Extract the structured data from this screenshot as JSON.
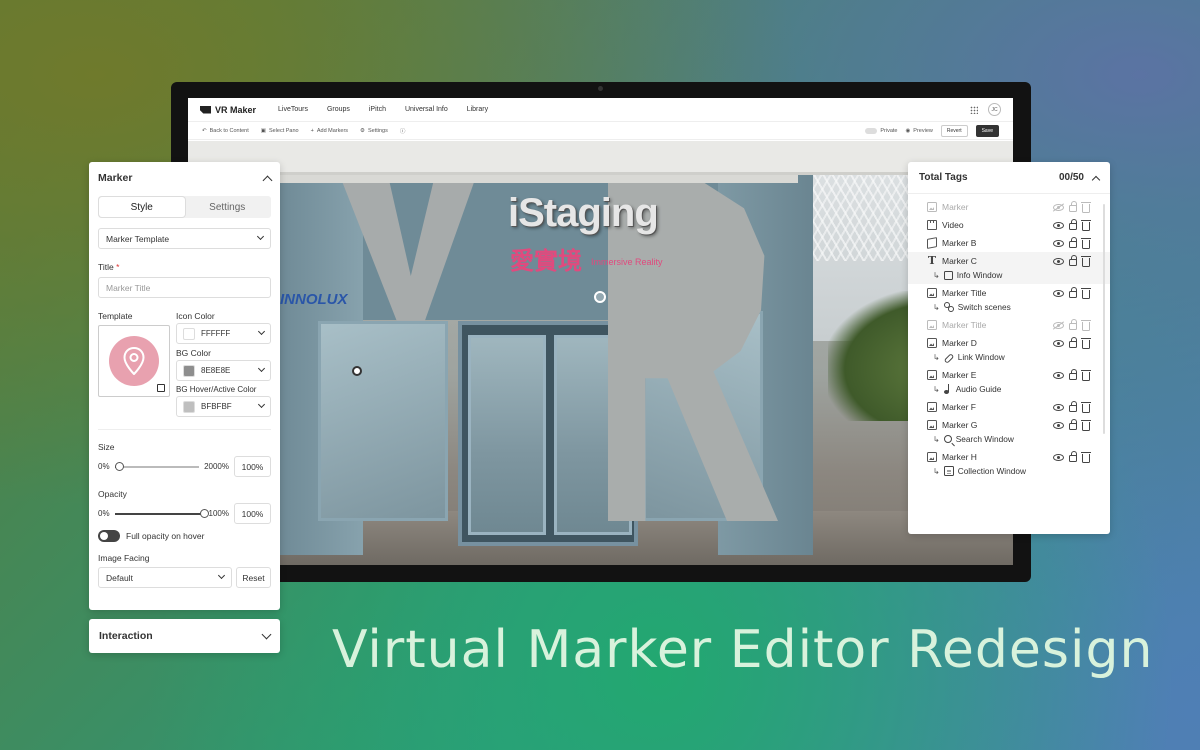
{
  "app": {
    "brand": "VR Maker",
    "nav": [
      "LiveTours",
      "Groups",
      "iPitch",
      "Universal Info",
      "Library"
    ],
    "avatar": "JC"
  },
  "toolbar": {
    "back": "Back to Content",
    "select_pano": "Select Pano",
    "add_markers": "Add Markers",
    "settings": "Settings",
    "private": "Private",
    "preview": "Preview",
    "revert": "Revert",
    "save": "Save"
  },
  "scene": {
    "sign_text": "iStaging",
    "sign_cn": "愛實境",
    "sign_sub": "Immersive Reality",
    "side_logo": "INNOLUX"
  },
  "marker_panel": {
    "title": "Marker",
    "tabs": [
      "Style",
      "Settings"
    ],
    "active_tab": "Style",
    "template_select": "Marker Template",
    "title_label": "Title",
    "required_mark": "*",
    "title_placeholder": "Marker Title",
    "template_label": "Template",
    "icon_color_label": "Icon Color",
    "icon_color": "FFFFFF",
    "bg_color_label": "BG Color",
    "bg_color": "8E8E8E",
    "bg_hover_label": "BG Hover/Active Color",
    "bg_hover_color": "BFBFBF",
    "size_label": "Size",
    "size_min": "0%",
    "size_max": "2000%",
    "size_value": "100%",
    "size_fraction": 0.05,
    "opacity_label": "Opacity",
    "opacity_min": "0%",
    "opacity_max": "100%",
    "opacity_value": "100%",
    "opacity_fraction": 1.0,
    "full_opacity_label": "Full opacity on hover",
    "full_opacity_on": true,
    "image_facing_label": "Image Facing",
    "image_facing_value": "Default",
    "reset": "Reset"
  },
  "interaction_panel": {
    "title": "Interaction"
  },
  "tags_panel": {
    "title": "Total Tags",
    "count": "00/50",
    "tags": [
      {
        "name": "Marker",
        "icon": "image-icon",
        "hidden": true,
        "sub": null
      },
      {
        "name": "Video",
        "icon": "video-icon",
        "hidden": false,
        "sub": null
      },
      {
        "name": "Marker B",
        "icon": "cube-icon",
        "hidden": false,
        "sub": null
      },
      {
        "name": "Marker C",
        "icon": "text-icon",
        "hidden": false,
        "sub": "Info Window",
        "sub_icon": "square-icon",
        "highlight": true
      },
      {
        "name": "Marker Title",
        "icon": "image-icon",
        "hidden": false,
        "sub": "Switch scenes",
        "sub_icon": "scene-icon"
      },
      {
        "name": "Marker Title",
        "icon": "image-icon",
        "hidden": true,
        "sub": null
      },
      {
        "name": "Marker D",
        "icon": "image-icon",
        "hidden": false,
        "sub": "Link Window",
        "sub_icon": "link-icon"
      },
      {
        "name": "Marker E",
        "icon": "image-icon",
        "hidden": false,
        "sub": "Audio Guide",
        "sub_icon": "music-note-icon"
      },
      {
        "name": "Marker F",
        "icon": "image-icon",
        "hidden": false,
        "sub": null
      },
      {
        "name": "Marker G",
        "icon": "image-icon",
        "hidden": false,
        "sub": "Search Window",
        "sub_icon": "search-icon"
      },
      {
        "name": "Marker H",
        "icon": "image-icon",
        "hidden": false,
        "sub": "Collection Window",
        "sub_icon": "collection-icon"
      }
    ]
  },
  "headline": "Virtual Marker Editor Redesign",
  "colors": {
    "accent_dark": "#444444",
    "template_pink": "#E8A1AF",
    "headline": "#D8F2DC"
  }
}
